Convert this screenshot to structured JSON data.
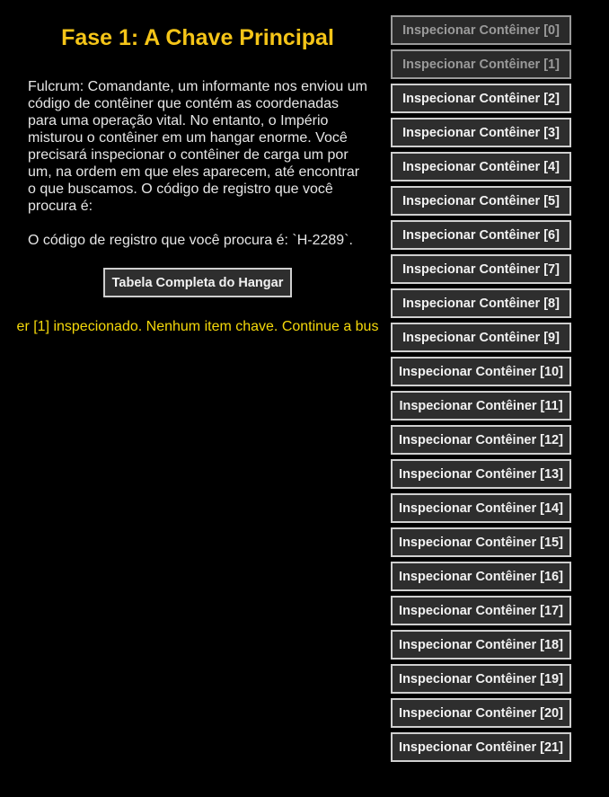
{
  "header": {
    "title": "Fase 1: A Chave Principal"
  },
  "intro": {
    "text": "Fulcrum: Comandante, um informante nos enviou um código de contêiner que contém as coordenadas para uma operação vital. No entanto, o Império misturou o contêiner em um hangar enorme. Você precisará inspecionar o contêiner de carga um por um, na ordem em que eles aparecem, até encontrar o que buscamos. O código de registro que você procura é:",
    "code_line": "O código de registro que você procura é: `H-2289`."
  },
  "actions": {
    "table_button_label": "Tabela Completa do Hangar"
  },
  "status": {
    "message": "er [1] inspecionado. Nenhum item chave. Continue a bus"
  },
  "containers": {
    "buttons": [
      {
        "label": "Inspecionar Contêiner [0]",
        "state": "disabled"
      },
      {
        "label": "Inspecionar Contêiner [1]",
        "state": "disabled"
      },
      {
        "label": "Inspecionar Contêiner [2]",
        "state": "enabled"
      },
      {
        "label": "Inspecionar Contêiner [3]",
        "state": "enabled"
      },
      {
        "label": "Inspecionar Contêiner [4]",
        "state": "enabled"
      },
      {
        "label": "Inspecionar Contêiner [5]",
        "state": "enabled"
      },
      {
        "label": "Inspecionar Contêiner [6]",
        "state": "enabled"
      },
      {
        "label": "Inspecionar Contêiner [7]",
        "state": "enabled"
      },
      {
        "label": "Inspecionar Contêiner [8]",
        "state": "enabled"
      },
      {
        "label": "Inspecionar Contêiner [9]",
        "state": "enabled"
      },
      {
        "label": "Inspecionar Contêiner [10]",
        "state": "enabled"
      },
      {
        "label": "Inspecionar Contêiner [11]",
        "state": "enabled"
      },
      {
        "label": "Inspecionar Contêiner [12]",
        "state": "enabled"
      },
      {
        "label": "Inspecionar Contêiner [13]",
        "state": "enabled"
      },
      {
        "label": "Inspecionar Contêiner [14]",
        "state": "enabled"
      },
      {
        "label": "Inspecionar Contêiner [15]",
        "state": "enabled"
      },
      {
        "label": "Inspecionar Contêiner [16]",
        "state": "enabled"
      },
      {
        "label": "Inspecionar Contêiner [17]",
        "state": "enabled"
      },
      {
        "label": "Inspecionar Contêiner [18]",
        "state": "enabled"
      },
      {
        "label": "Inspecionar Contêiner [19]",
        "state": "enabled"
      },
      {
        "label": "Inspecionar Contêiner [20]",
        "state": "enabled"
      },
      {
        "label": "Inspecionar Contêiner [21]",
        "state": "enabled"
      }
    ]
  },
  "colors": {
    "background": "#000000",
    "title": "#f5c518",
    "body_text": "#e6e6e6",
    "status_text": "#f5d90a",
    "button_bg": "#2e2e2e",
    "button_border": "#cfcfcf",
    "button_disabled_text": "#9a9a9a"
  }
}
